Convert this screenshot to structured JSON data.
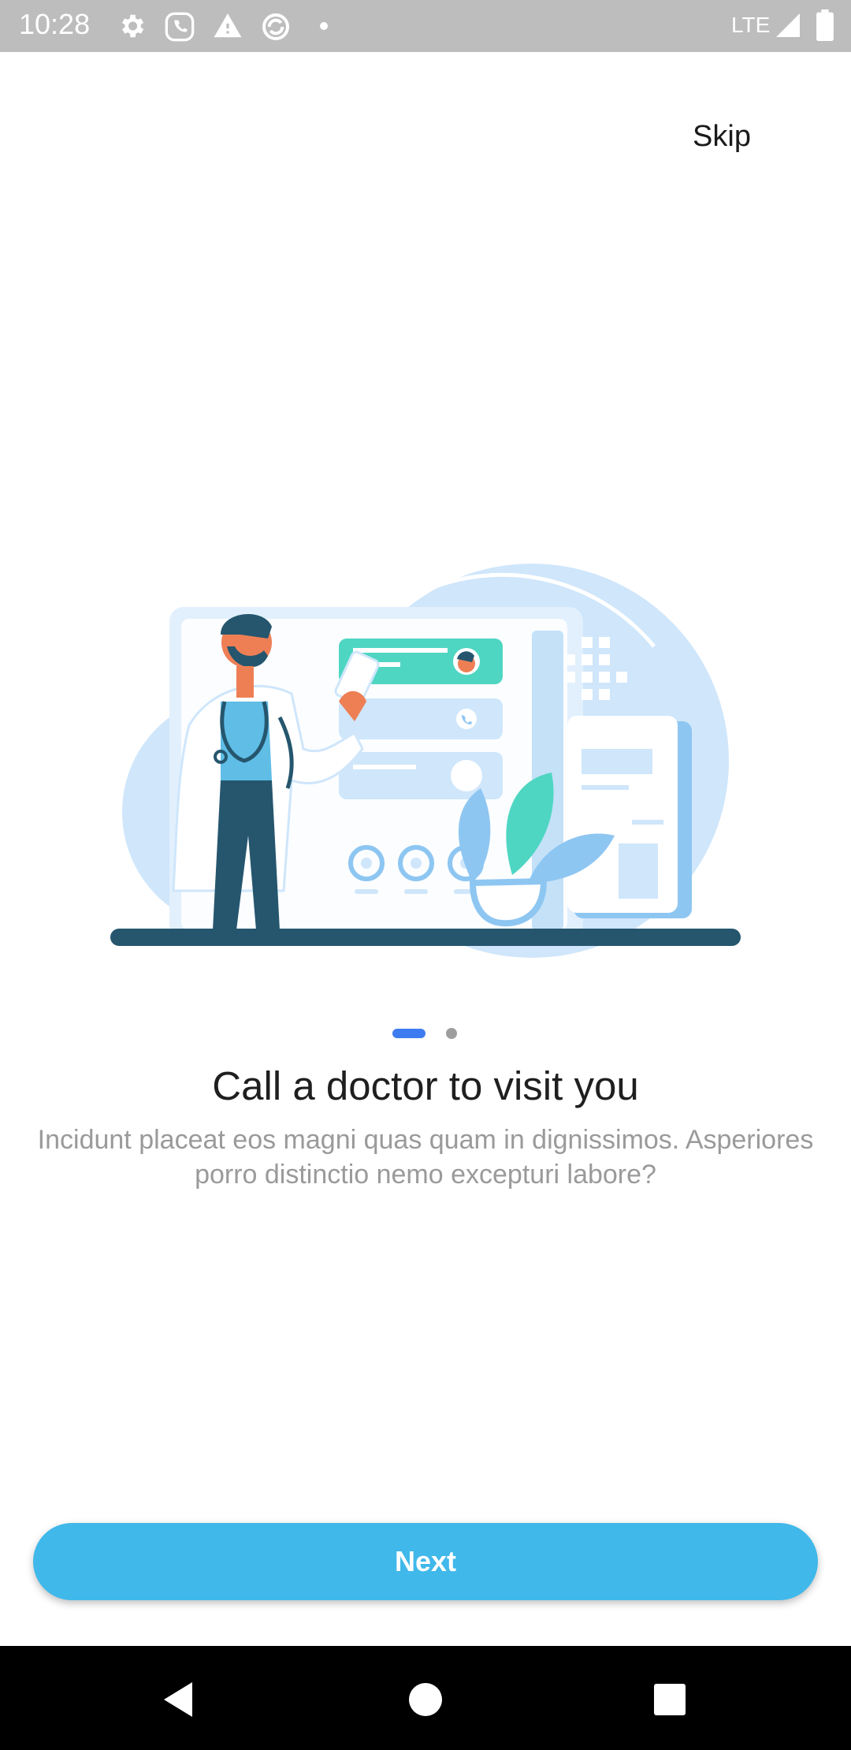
{
  "status_bar": {
    "time": "10:28",
    "network": "LTE",
    "icons": [
      "gear-icon",
      "phone-icon",
      "warning-icon",
      "sync-icon",
      "dot-icon",
      "signal-icon",
      "battery-icon"
    ]
  },
  "skip_label": "Skip",
  "pager": {
    "total": 2,
    "active_index": 0,
    "active_color": "#3d7cf0",
    "inactive_color": "#9e9e9e"
  },
  "onboarding": {
    "title": "Call a doctor to visit you",
    "subtitle": "Incidunt placeat eos magni quas quam in dignissimos. Asperiores porro distinctio nemo excepturi labore?"
  },
  "next_label": "Next",
  "colors": {
    "accent": "#40b8ea",
    "illustration_light": "#cfe6fb",
    "illustration_mid": "#8ec6f2",
    "illustration_teal": "#4fd6c2",
    "illustration_dark": "#25566e",
    "skin": "#ee7f55"
  },
  "nav_bar": {
    "icons": [
      "back-icon",
      "home-icon",
      "recents-icon"
    ]
  }
}
